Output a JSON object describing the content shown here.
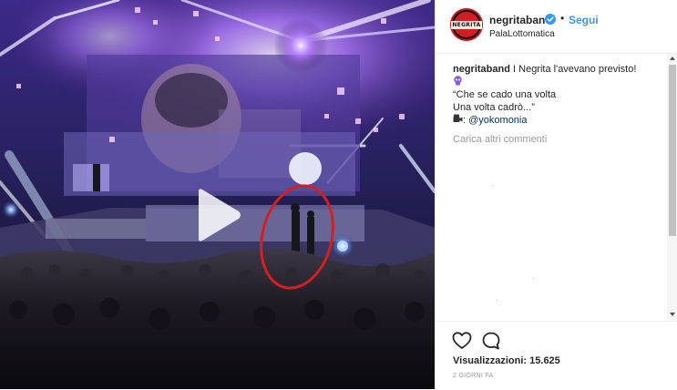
{
  "post": {
    "username": "negritaband",
    "separator": "•",
    "follow_label": "Segui",
    "location": "PalaLottomatica",
    "avatar_text": "NEGRITA",
    "caption": {
      "user": "negritaband",
      "text": "I Negrita l'avevano previsto!",
      "emoji_1": "purple-skull-emoji",
      "quote_line_1": "“Che se cado una volta",
      "quote_line_2": "Una volta cadrò...”",
      "emoji_2": "video-camera-emoji",
      "credit_sep": ":",
      "mention": "@yokomonia"
    },
    "load_more_label": "Carica altri commenti",
    "views_label": "Visualizzazioni: 15.625",
    "timestamp": "2 GIORNI FA"
  },
  "icons": {
    "verified": "verified-badge-icon",
    "like": "heart-icon",
    "comment": "speech-bubble-icon",
    "play": "play-icon"
  },
  "colors": {
    "accent": "#3897f0",
    "avatar_red": "#c4161c",
    "annotation_circle": "#d22020",
    "stage_purple": "#8a5cff"
  }
}
